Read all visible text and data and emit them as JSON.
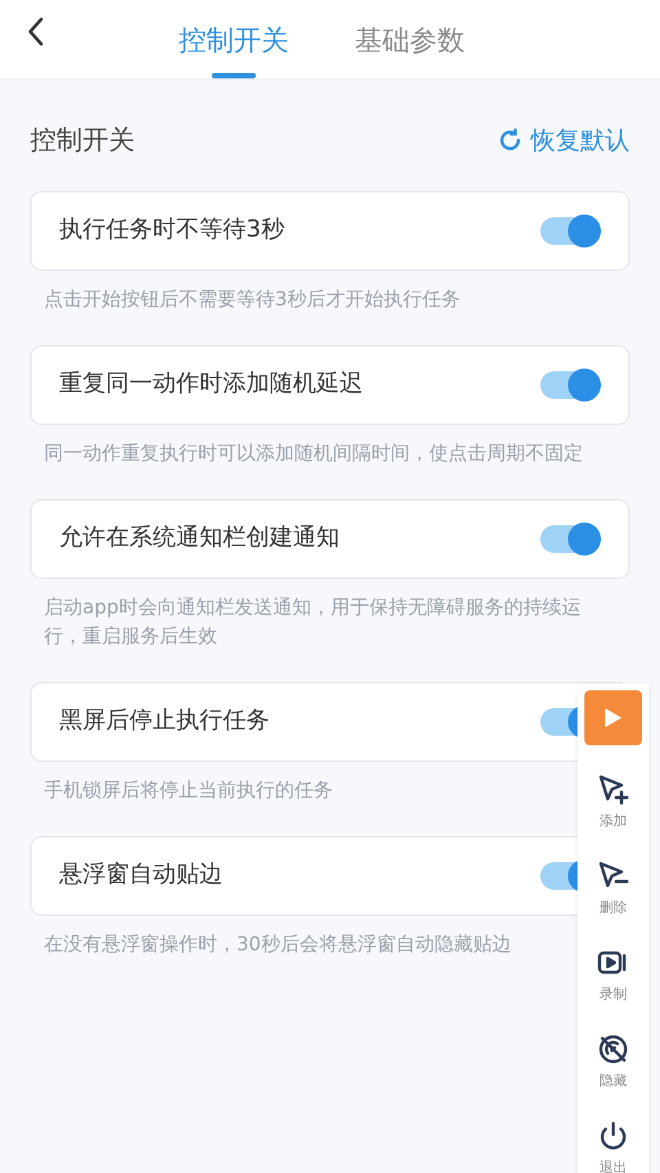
{
  "tabs": [
    {
      "label": "控制开关",
      "selected": true
    },
    {
      "label": "基础参数",
      "selected": false
    }
  ],
  "section": {
    "title": "控制开关",
    "reset_label": "恢复默认"
  },
  "settings": [
    {
      "label": "执行任务时不等待3秒",
      "on": true,
      "description": "点击开始按钮后不需要等待3秒后才开始执行任务"
    },
    {
      "label": "重复同一动作时添加随机延迟",
      "on": true,
      "description": "同一动作重复执行时可以添加随机间隔时间，使点击周期不固定"
    },
    {
      "label": "允许在系统通知栏创建通知",
      "on": true,
      "description": "启动app时会向通知栏发送通知，用于保持无障碍服务的持续运行，重启服务后生效"
    },
    {
      "label": "黑屏后停止执行任务",
      "on": true,
      "description": "手机锁屏后将停止当前执行的任务"
    },
    {
      "label": "悬浮窗自动贴边",
      "on": true,
      "description": "在没有悬浮窗操作时，30秒后会将悬浮窗自动隐藏贴边"
    }
  ],
  "floating_panel": {
    "actions": [
      {
        "kind": "add",
        "label": "添加"
      },
      {
        "kind": "remove",
        "label": "删除"
      },
      {
        "kind": "record",
        "label": "录制"
      },
      {
        "kind": "hide",
        "label": "隐藏"
      },
      {
        "kind": "exit",
        "label": "退出"
      }
    ]
  }
}
